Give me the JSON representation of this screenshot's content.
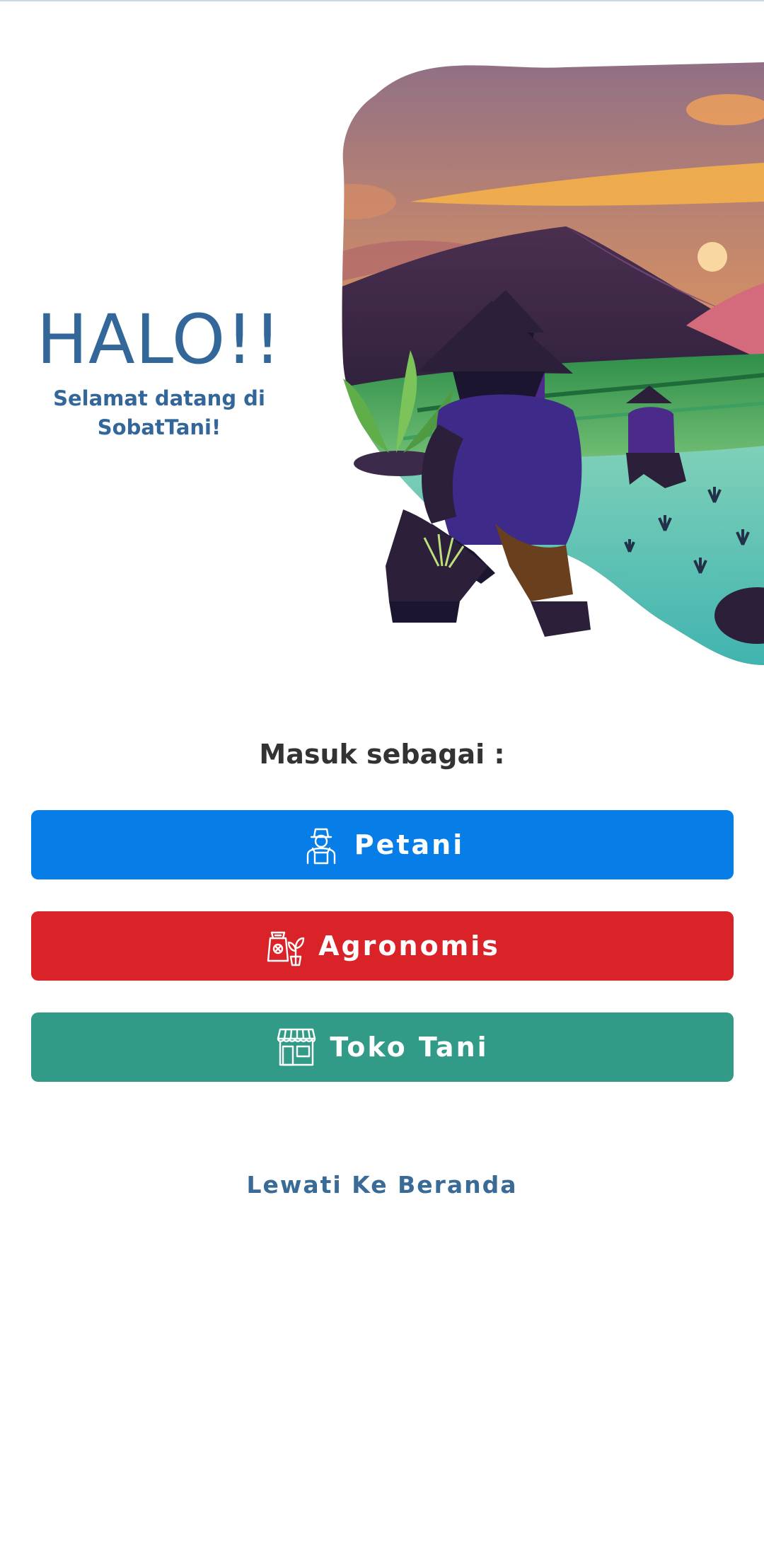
{
  "greeting": {
    "title": "HALO!!",
    "subtitle": "Selamat datang di\nSobatTani!"
  },
  "login": {
    "label": "Masuk sebagai :",
    "buttons": [
      {
        "label": "Petani",
        "icon": "farmer-icon",
        "color": "#077de8"
      },
      {
        "label": "Agronomis",
        "icon": "agronomist-icon",
        "color": "#da2229"
      },
      {
        "label": "Toko Tani",
        "icon": "store-icon",
        "color": "#319b88"
      }
    ]
  },
  "skip": {
    "label": "Lewati Ke Beranda"
  },
  "colors": {
    "primary_text": "#336699",
    "heading_text": "#333333"
  }
}
